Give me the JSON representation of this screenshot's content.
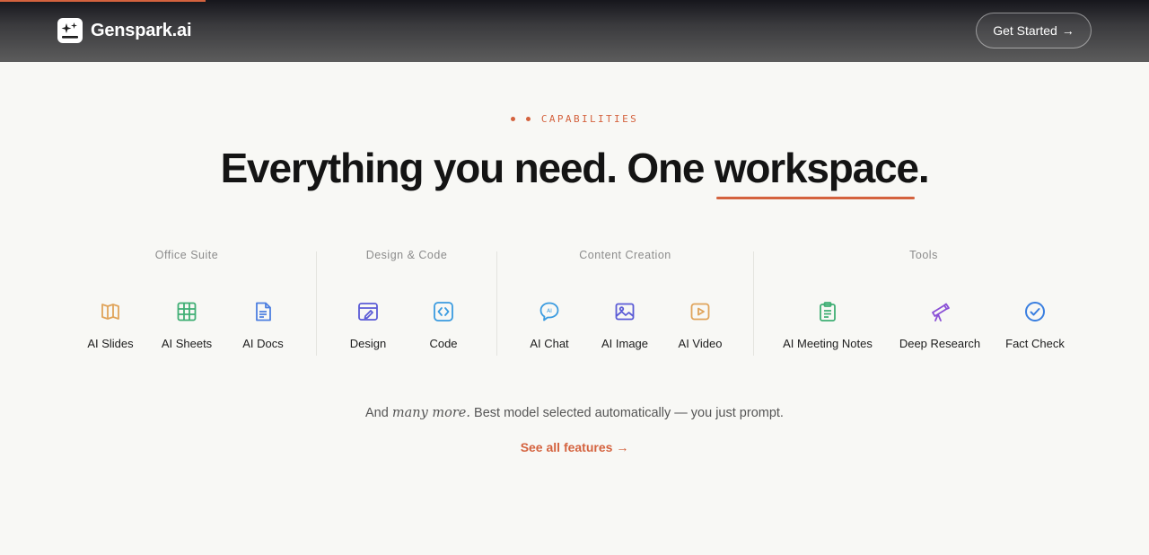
{
  "header": {
    "logo_text": "Genspark.ai",
    "cta_label": "Get Started",
    "cta_arrow": "→"
  },
  "hero": {
    "eyebrow": "CAPABILITIES",
    "headline_part1": "Everything you need. One ",
    "headline_accent": "workspace",
    "headline_end": ".",
    "accent_color": "#d4623e"
  },
  "groups": [
    {
      "label": "Office Suite",
      "items": [
        {
          "label": "AI Slides",
          "icon": "book-open-icon",
          "color": "#e0a45b"
        },
        {
          "label": "AI Sheets",
          "icon": "grid-icon",
          "color": "#3fae74"
        },
        {
          "label": "AI Docs",
          "icon": "document-icon",
          "color": "#4d7fe0"
        }
      ]
    },
    {
      "label": "Design & Code",
      "items": [
        {
          "label": "Design",
          "icon": "design-window-icon",
          "color": "#5b5bd6"
        },
        {
          "label": "Code",
          "icon": "code-brackets-icon",
          "color": "#3a9be0"
        }
      ]
    },
    {
      "label": "Content Creation",
      "items": [
        {
          "label": "AI Chat",
          "icon": "chat-bubble-icon",
          "color": "#3a9be0"
        },
        {
          "label": "AI Image",
          "icon": "image-icon",
          "color": "#5b5bd6"
        },
        {
          "label": "AI Video",
          "icon": "play-video-icon",
          "color": "#e0a45b"
        }
      ]
    },
    {
      "label": "Tools",
      "items": [
        {
          "label": "AI Meeting Notes",
          "icon": "clipboard-icon",
          "color": "#3fae74"
        },
        {
          "label": "Deep Research",
          "icon": "telescope-icon",
          "color": "#8a4fd6"
        },
        {
          "label": "Fact Check",
          "icon": "check-circle-icon",
          "color": "#3a7fe0"
        }
      ]
    }
  ],
  "footer": {
    "tagline_start": "And ",
    "tagline_em": "many more.",
    "tagline_end": " Best model selected automatically — you just prompt.",
    "see_all_label": "See all features",
    "see_all_arrow": "→"
  }
}
